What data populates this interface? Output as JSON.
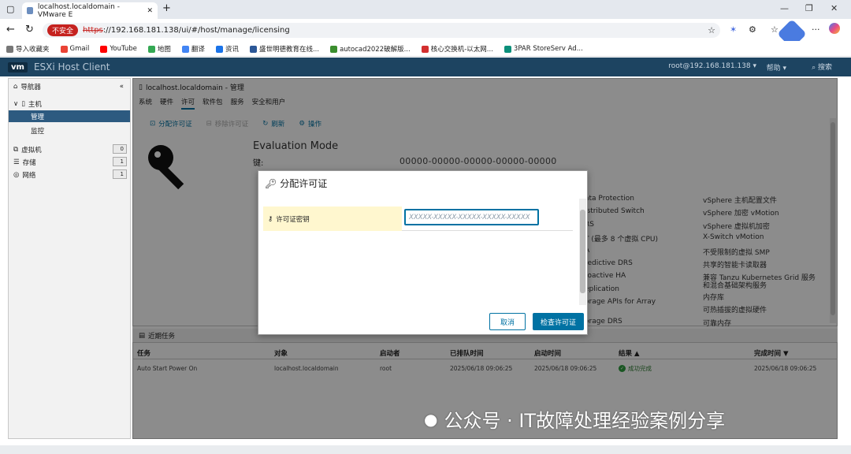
{
  "browser": {
    "tab_title": "localhost.localdomain - VMware E",
    "unsafe_label": "不安全",
    "url_scheme": "https",
    "url_rest": "://192.168.181.138/ui/#/host/manage/licensing",
    "bookmarks": [
      {
        "label": "导入收藏夹",
        "color": "#777"
      },
      {
        "label": "Gmail",
        "color": "#ea4335"
      },
      {
        "label": "YouTube",
        "color": "#ff0000"
      },
      {
        "label": "地图",
        "color": "#34a853"
      },
      {
        "label": "翻译",
        "color": "#4285f4"
      },
      {
        "label": "资讯",
        "color": "#1a73e8"
      },
      {
        "label": "盛世明德教育在线...",
        "color": "#2b5797"
      },
      {
        "label": "autocad2022破解版...",
        "color": "#3b8e2e"
      },
      {
        "label": "核心交换机-以太网...",
        "color": "#d32f2f"
      },
      {
        "label": "3PAR StoreServ Ad...",
        "color": "#0b8f7a"
      }
    ]
  },
  "esxi": {
    "logo": "vm",
    "title": "ESXi Host Client",
    "user": "root@192.168.181.138 ▾",
    "help": "帮助 ▾",
    "search": "搜索"
  },
  "navigator": {
    "title": "导航器",
    "host": "主机",
    "manage": "管理",
    "monitor": "监控",
    "vms": {
      "label": "虚拟机",
      "count": "0"
    },
    "storage": {
      "label": "存储",
      "count": "1"
    },
    "network": {
      "label": "网络",
      "count": "1"
    }
  },
  "main": {
    "title": "localhost.localdomain - 管理",
    "tabs": [
      "系统",
      "硬件",
      "许可",
      "软件包",
      "服务",
      "安全和用户"
    ],
    "toolbar": {
      "assign": "分配许可证",
      "remove": "移除许可证",
      "refresh": "刷新",
      "actions": "操作"
    },
    "eval_mode": "Evaluation Mode",
    "key_label": "键:",
    "key_value": "00000-00000-00000-00000-00000",
    "features_left": [
      "ata Protection",
      "istributed Switch",
      "RS",
      "T (最多 8 个虚拟 CPU)",
      "A",
      "redictive DRS",
      "roactive HA",
      "eplication",
      "orage APIs for Array",
      "orage DRS"
    ],
    "features_right": [
      "vSphere 主机配置文件",
      "vSphere 加密 vMotion",
      "vSphere 虚拟机加密",
      "X-Switch vMotion",
      "不受限制的虚拟 SMP",
      "共享的智能卡读取器",
      "兼容 Tanzu Kubernetes Grid 服务",
      "和混合基础架构服务",
      "内存库",
      "可热插拔的虚拟硬件",
      "可靠内存"
    ]
  },
  "tasks": {
    "title": "近期任务",
    "columns": [
      "任务",
      "对象",
      "启动者",
      "已排队时间",
      "启动时间",
      "结果 ▲",
      "完成时间 ▼"
    ],
    "rows": [
      {
        "task": "Auto Start Power On",
        "object": "localhost.localdomain",
        "initiator": "root",
        "queued": "2025/06/18 09:06:25",
        "started": "2025/06/18 09:06:25",
        "result": "成功完成",
        "completed": "2025/06/18 09:06:25"
      }
    ]
  },
  "dialog": {
    "title": "分配许可证",
    "field_label": "许可证密钥",
    "placeholder": "XXXXX-XXXXX-XXXXX-XXXXX-XXXXX",
    "cancel": "取消",
    "check": "检查许可证"
  },
  "watermark": "公众号 · IT故障处理经验案例分享"
}
